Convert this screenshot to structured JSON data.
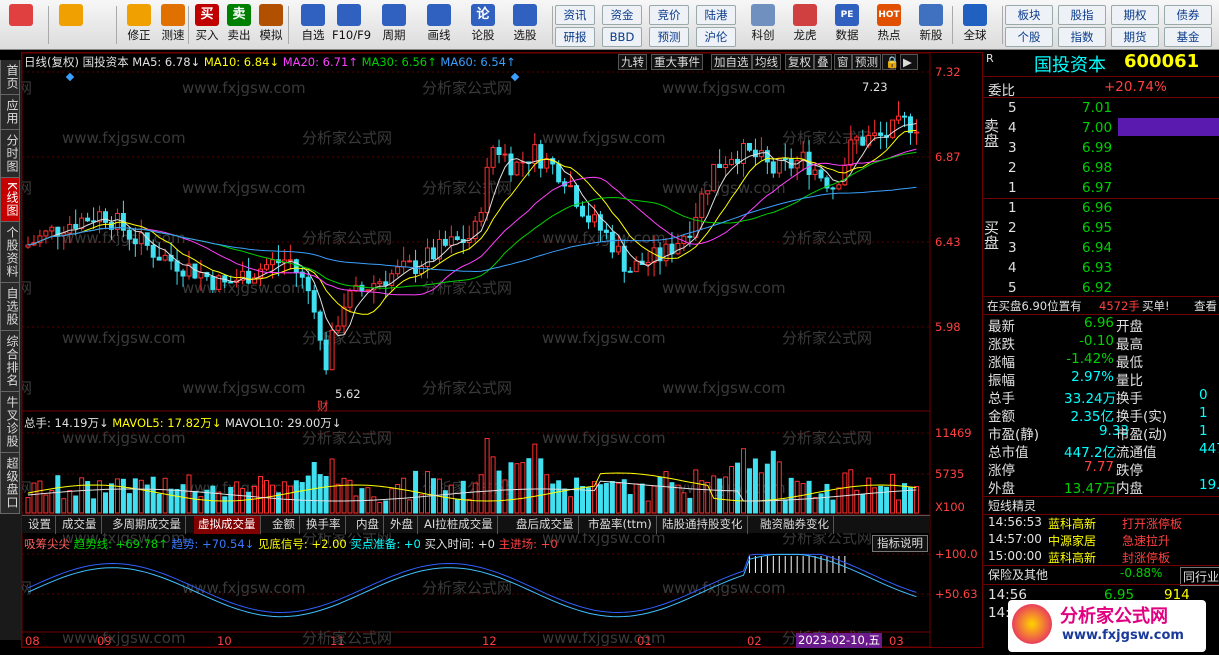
{
  "toolbar": {
    "items": [
      {
        "label": "",
        "icon": "windows-icon"
      },
      {
        "label": "",
        "icon": "back-arrow-icon"
      },
      {
        "label": "修正",
        "icon": "edit-icon"
      },
      {
        "label": "测速",
        "icon": "speed-test-icon"
      },
      {
        "label": "买入",
        "icon": "buy-icon",
        "glyph": "买"
      },
      {
        "label": "卖出",
        "icon": "sell-icon",
        "glyph": "卖"
      },
      {
        "label": "模拟",
        "icon": "simulate-icon"
      },
      {
        "label": "自选",
        "icon": "favorites-icon"
      },
      {
        "label": "F10/F9",
        "icon": "f10-icon"
      },
      {
        "label": "周期",
        "icon": "period-icon"
      },
      {
        "label": "画线",
        "icon": "draw-line-icon"
      },
      {
        "label": "论股",
        "icon": "discuss-icon",
        "glyph": "论"
      },
      {
        "label": "选股",
        "icon": "stock-picker-icon"
      }
    ],
    "buttons_row1": [
      "资讯",
      "资金",
      "竞价",
      "陆港"
    ],
    "buttons_row2": [
      "研报",
      "BBD",
      "预测",
      "沪伦"
    ],
    "items2": [
      {
        "label": "科创",
        "icon": "star-market-icon"
      },
      {
        "label": "龙虎",
        "icon": "dragon-tiger-icon"
      },
      {
        "label": "数据",
        "icon": "data-icon",
        "glyph": "PE"
      },
      {
        "label": "热点",
        "icon": "hot-icon",
        "glyph": "HOT"
      },
      {
        "label": "新股",
        "icon": "ipo-icon"
      },
      {
        "label": "全球",
        "icon": "globe-icon"
      }
    ],
    "buttons_right_row1": [
      "板块",
      "股指",
      "期权",
      "债券"
    ],
    "buttons_right_row2": [
      "个股",
      "指数",
      "期货",
      "基金"
    ]
  },
  "left_tabs": [
    "首页",
    "应用",
    "分时图",
    "K线图",
    "个股资料",
    "自选股",
    "综合排名",
    "牛叉诊股",
    "超级盘口"
  ],
  "kline": {
    "legend": {
      "period": "日线(复权)",
      "name": "国投资本",
      "ma5": "MA5: 6.78↓",
      "ma10": "MA10: 6.84↓",
      "ma20": "MA20: 6.71↑",
      "ma30": "MA30: 6.56↑",
      "ma60": "MA60: 6.54↑"
    },
    "top_buttons": [
      "九转",
      "重大事件",
      "加自选",
      "均线",
      "复权",
      "叠",
      "窗",
      "预测"
    ],
    "y_labels": [
      "7.32",
      "6.87",
      "6.43",
      "5.98"
    ],
    "high_label": "7.23",
    "low_label": "5.62",
    "marker": "财"
  },
  "volume": {
    "legend_total": "总手: 14.19万↓",
    "legend_mavol5": "MAVOL5: 17.82万↓",
    "legend_mavol10": "MAVOL10: 29.00万↓",
    "y_labels": [
      "11469",
      "5735"
    ],
    "unit": "X100"
  },
  "bottom_tabs": [
    "设置",
    "成交量",
    "多周期成交量",
    "虚拟成交量",
    "金额",
    "换手率",
    "内盘",
    "外盘",
    "AI拉桩成交量",
    "盘后成交量",
    "市盈率(ttm)",
    "陆股通持股变化",
    "融资融券变化"
  ],
  "indicator": {
    "name": "吸筹尖尖",
    "trend_line": "趋势线: +69.78↑",
    "trend": "趋势: +70.54↓",
    "bottom_signal": "见底信号: +2.00",
    "buy_ready": "买点准备: +0",
    "buy_time": "买入时间: +0",
    "main_enter": "主进场: +0",
    "help": "指标说明",
    "y_labels": [
      "+100.0",
      "+50.63"
    ]
  },
  "x_axis": [
    "08",
    "09",
    "10",
    "11",
    "12",
    "01",
    "02",
    "03"
  ],
  "x_cursor_date": "2023-02-10,五",
  "right_panel": {
    "stock_name": "国投资本",
    "stock_code": "600061",
    "r_label": "R",
    "weibi_label": "委比",
    "weibi_value": "+20.74%",
    "sell_label": "卖盘",
    "buy_label": "买盘",
    "sell_rows": [
      {
        "n": "5",
        "p": "7.01"
      },
      {
        "n": "4",
        "p": "7.00"
      },
      {
        "n": "3",
        "p": "6.99"
      },
      {
        "n": "2",
        "p": "6.98"
      },
      {
        "n": "1",
        "p": "6.97"
      }
    ],
    "buy_rows": [
      {
        "n": "1",
        "p": "6.96"
      },
      {
        "n": "2",
        "p": "6.95"
      },
      {
        "n": "3",
        "p": "6.94"
      },
      {
        "n": "4",
        "p": "6.93"
      },
      {
        "n": "5",
        "p": "6.92"
      }
    ],
    "buy_line": "在买盘6.90位置有",
    "buy_line_vol": "4572手",
    "buy_line_tail": "买单!",
    "buy_line_link": "查看",
    "quote_left": [
      {
        "k": "最新",
        "v": "6.96"
      },
      {
        "k": "涨跌",
        "v": "-0.10"
      },
      {
        "k": "涨幅",
        "v": "-1.42%"
      },
      {
        "k": "振幅",
        "v": "2.97%"
      },
      {
        "k": "总手",
        "v": "33.24万"
      },
      {
        "k": "金额",
        "v": "2.35亿"
      },
      {
        "k": "市盈(静)",
        "v": "9.33"
      },
      {
        "k": "总市值",
        "v": "447.2亿"
      },
      {
        "k": "涨停",
        "v": "7.77"
      },
      {
        "k": "外盘",
        "v": "13.47万"
      }
    ],
    "quote_right": [
      {
        "k": "开盘",
        "v": ""
      },
      {
        "k": "最高",
        "v": ""
      },
      {
        "k": "最低",
        "v": ""
      },
      {
        "k": "量比",
        "v": ""
      },
      {
        "k": "换手",
        "v": "0"
      },
      {
        "k": "换手(实)",
        "v": "1"
      },
      {
        "k": "市盈(动)",
        "v": "1"
      },
      {
        "k": "流通值",
        "v": "447"
      },
      {
        "k": "跌停",
        "v": ""
      },
      {
        "k": "内盘",
        "v": "19."
      }
    ],
    "short_title": "短线精灵",
    "short_rows": [
      {
        "t": "14:56:53",
        "n": "蓝科高新",
        "e": "打开涨停板"
      },
      {
        "t": "14:57:00",
        "n": "中源家居",
        "e": "急速拉升"
      },
      {
        "t": "15:00:00",
        "n": "蓝科高新",
        "e": "封涨停板"
      }
    ],
    "sector_name": "保险及其他",
    "sector_change": "-0.88%",
    "sector_btn": "同行业",
    "trade_time": "14:56",
    "trade_price": "6.95",
    "trade_vol": "914",
    "trade_time2": "14:56"
  },
  "watermark": {
    "text": "分析家公式网",
    "url": "www.fxjgsw.com"
  }
}
